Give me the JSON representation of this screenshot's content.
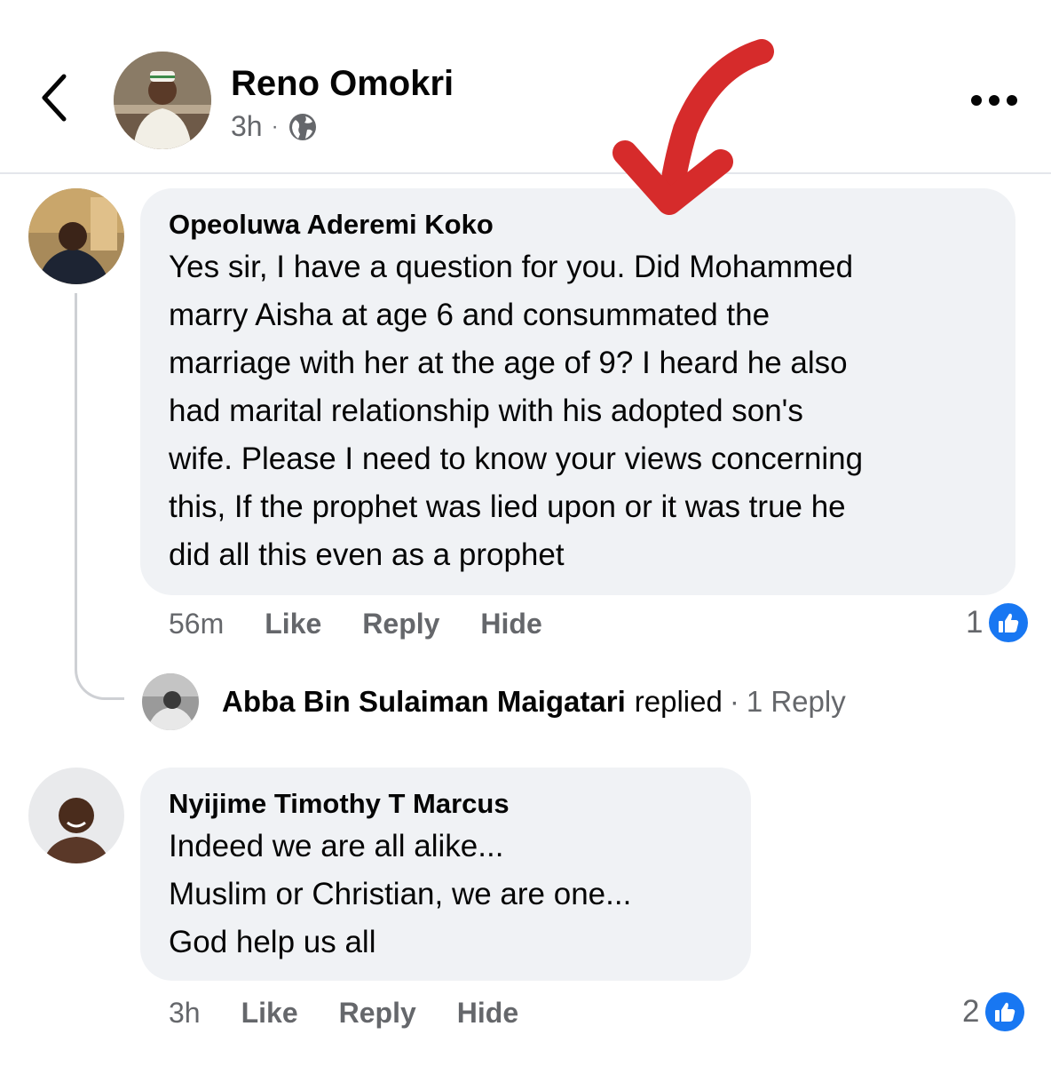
{
  "post": {
    "author": "Reno Omokri",
    "time": "3h",
    "separator": "·",
    "privacy_icon": "globe-icon"
  },
  "icons": {
    "back": "chevron-left-icon",
    "more": "more-options-icon",
    "like": "like-thumb-icon"
  },
  "colors": {
    "accent": "#1877f2",
    "bubble": "#f0f2f5",
    "secondary_text": "#65676b",
    "annotation_arrow": "#d62b2b"
  },
  "comments": [
    {
      "author": "Opeoluwa Aderemi Koko",
      "lines": [
        "Yes sir, I have a question for you. Did Mohammed",
        "marry Aisha at age 6 and consummated the",
        "marriage with her at the age of 9? I heard he also",
        "had marital relationship with his adopted son's",
        "wife. Please I need to know your views concerning",
        "this, If the prophet was lied upon or it was true he",
        "did all this even as a prophet"
      ],
      "time": "56m",
      "like_label": "Like",
      "reply_label": "Reply",
      "hide_label": "Hide",
      "reaction_count": "1",
      "reply_preview": {
        "name": "Abba Bin Sulaiman Maigatari",
        "action": "replied",
        "separator": "·",
        "count_label": "1 Reply"
      }
    },
    {
      "author": "Nyijime Timothy T Marcus",
      "lines": [
        "Indeed we are all alike...",
        "Muslim or Christian,  we are one...",
        "God help us all"
      ],
      "time": "3h",
      "like_label": "Like",
      "reply_label": "Reply",
      "hide_label": "Hide",
      "reaction_count": "2"
    }
  ]
}
